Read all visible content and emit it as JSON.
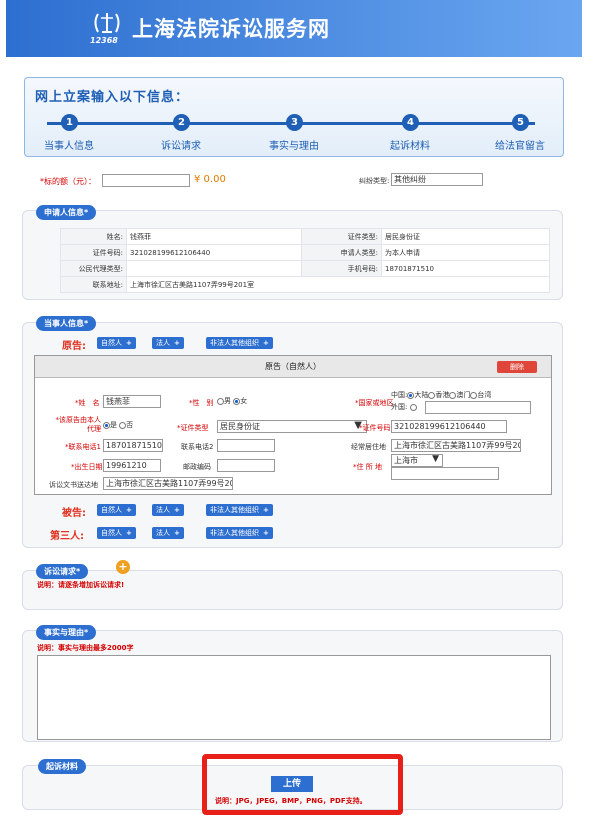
{
  "header": {
    "logo_number": "12368",
    "site_title": "上海法院诉讼服务网"
  },
  "steps": {
    "title": "网上立案输入以下信息：",
    "items": [
      {
        "num": "1",
        "label": "当事人信息"
      },
      {
        "num": "2",
        "label": "诉讼请求"
      },
      {
        "num": "3",
        "label": "事实与理由"
      },
      {
        "num": "4",
        "label": "起诉材料"
      },
      {
        "num": "5",
        "label": "给法官留言"
      }
    ]
  },
  "amount": {
    "label": "*标的额（元）：",
    "value": "",
    "display": "¥ 0.00",
    "case_type_label": "纠纷类型:",
    "case_type_value": "其他纠纷"
  },
  "applicant": {
    "title": "申请人信息*",
    "rows": [
      [
        "姓名:",
        "钱燕菲",
        "证件类型:",
        "居民身份证"
      ],
      [
        "证件号码:",
        "321028199612106440",
        "申请人类型:",
        "为本人申请"
      ],
      [
        "公民代理类型:",
        "",
        "手机号码:",
        "18701871510"
      ],
      [
        "联系地址:",
        "上海市徐汇区古美路1107弄99号201室",
        "",
        ""
      ]
    ]
  },
  "party": {
    "title": "当事人信息*",
    "plaintiff": "原告:",
    "defendant": "被告:",
    "third": "第三人:",
    "btn_natural": "自然人",
    "btn_legal": "法人",
    "btn_other": "非法人其他组织",
    "plus": "+",
    "box_title": "原告（自然人）",
    "delete": "删除",
    "name_label": "*姓　名",
    "name_value": "钱燕菲",
    "gender_label": "*性　别",
    "gender_male": "男",
    "gender_female": "女",
    "region_label": "*国家或地区",
    "region_cn": "中国:",
    "region_mainland": "大陆",
    "region_hk": "香港",
    "region_mo": "澳门",
    "region_tw": "台湾",
    "region_foreign": "外国:",
    "region_foreign_value": "",
    "self_label": "*该原告由本人代理",
    "self_yes": "是",
    "self_no": "否",
    "idtype_label": "*证件类型",
    "idtype_value": "居民身份证",
    "idno_label": "*证件号码",
    "idno_value": "321028199612106440",
    "phone1_label": "*联系电话1",
    "phone1_value": "18701871510",
    "phone2_label": "联系电话2",
    "phone2_value": "",
    "residence_label": "经常居住地",
    "residence_value": "上海市徐汇区古美路1107弄99号201室",
    "birth_label": "*出生日期",
    "birth_value": "19961210",
    "zip_label": "邮政编码",
    "zip_value": "",
    "addr_label": "*住 所 地",
    "addr_city": "上海市",
    "addr_value": "",
    "doc_label": "诉讼文书送达地",
    "doc_value": "上海市徐汇区古美路1107弄99号201室"
  },
  "claims": {
    "title": "诉讼请求*",
    "add": "+",
    "hint": "说明：请逐条增加诉讼请求!"
  },
  "facts": {
    "title": "事实与理由*",
    "hint": "说明：事实与理由最多2000字",
    "value": ""
  },
  "materials": {
    "title": "起诉材料",
    "upload": "上传",
    "hint": "说明：JPG，JPEG，BMP，PNG，PDF支持。"
  }
}
